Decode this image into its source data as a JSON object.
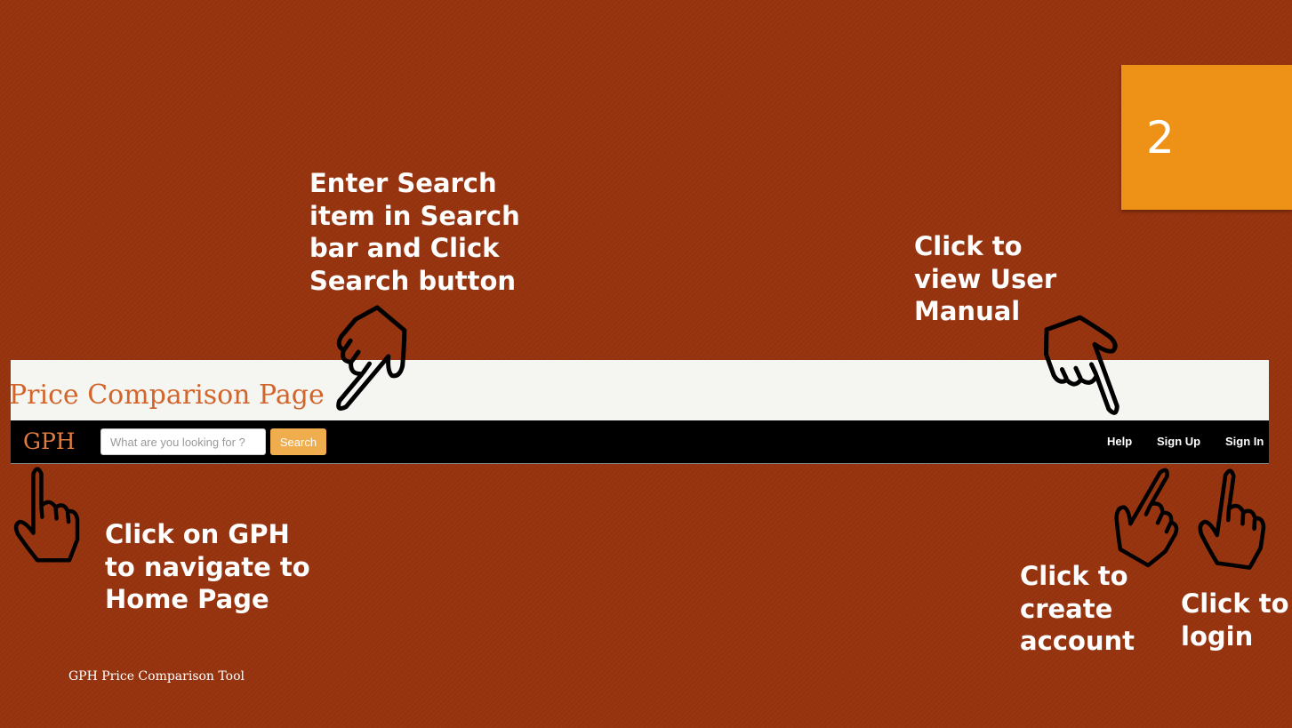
{
  "slide": {
    "number": "2",
    "footer": "GPH Price Comparison Tool",
    "accent_color": "#ee9217",
    "background_color": "#96330f"
  },
  "app": {
    "banner_title": "Price Comparison Page",
    "brand": "GPH",
    "search_placeholder": "What are you looking for ?",
    "search_button": "Search",
    "nav_links": {
      "help": "Help",
      "sign_up": "Sign Up",
      "sign_in": "Sign In"
    }
  },
  "callouts": {
    "search": [
      "Enter Search",
      "item in Search",
      "bar and Click",
      "Search button"
    ],
    "help": [
      "Click to",
      "view User",
      "Manual"
    ],
    "home": [
      "Click on GPH",
      "to navigate to",
      "Home Page"
    ],
    "signup": [
      "Click to",
      "create",
      "account"
    ],
    "signin": [
      "Click to",
      "login"
    ]
  },
  "icons": {
    "pointer": "pointing-hand-icon"
  }
}
